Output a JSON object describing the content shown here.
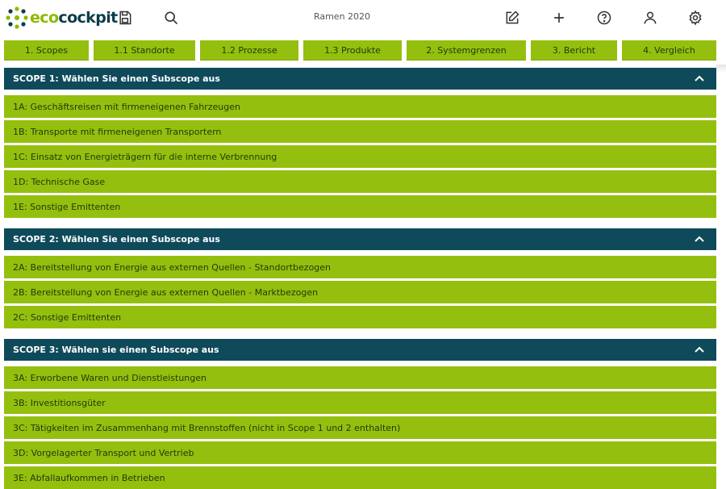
{
  "header": {
    "logo_eco": "eco",
    "logo_cockpit": "cockpit",
    "project_title": "Ramen 2020",
    "icons": [
      "save-icon",
      "search-icon",
      "edit-icon",
      "plus-icon",
      "help-icon",
      "user-icon",
      "settings-icon"
    ]
  },
  "tabs": [
    {
      "label": "1. Scopes"
    },
    {
      "label": "1.1 Standorte"
    },
    {
      "label": "1.2 Prozesse"
    },
    {
      "label": "1.3 Produkte"
    },
    {
      "label": "2. Systemgrenzen"
    },
    {
      "label": "3. Bericht"
    },
    {
      "label": "4. Vergleich"
    }
  ],
  "sections": [
    {
      "title": "SCOPE 1: Wählen Sie einen Subscope aus",
      "items": [
        {
          "label": "1A: Geschäftsreisen mit firmeneigenen Fahrzeugen"
        },
        {
          "label": "1B: Transporte mit firmeneigenen Transportern"
        },
        {
          "label": "1C: Einsatz von Energieträgern für die interne Verbrennung"
        },
        {
          "label": "1D: Technische Gase"
        },
        {
          "label": "1E: Sonstige Emittenten"
        }
      ]
    },
    {
      "title": "SCOPE 2: Wählen Sie einen Subscope aus",
      "items": [
        {
          "label": "2A: Bereitstellung von Energie aus externen Quellen - Standortbezogen"
        },
        {
          "label": "2B: Bereitstellung von Energie aus externen Quellen - Marktbezogen"
        },
        {
          "label": "2C: Sonstige Emittenten"
        }
      ]
    },
    {
      "title": "SCOPE 3: Wählen sie einen Subscope aus",
      "items": [
        {
          "label": "3A: Erworbene Waren und Dienstleistungen"
        },
        {
          "label": "3B: Investitionsgüter"
        },
        {
          "label": "3C: Tätigkeiten im Zusammenhang mit Brennstoffen (nicht in Scope 1 und 2 enthalten)"
        },
        {
          "label": "3D: Vorgelagerter Transport und Vertrieb"
        },
        {
          "label": "3E: Abfallaufkommen in Betrieben"
        }
      ]
    }
  ],
  "colors": {
    "accent_green": "#95bf0e",
    "section_header": "#0e4a5a",
    "logo_green": "#8db900",
    "logo_dark": "#0d3c4a"
  }
}
